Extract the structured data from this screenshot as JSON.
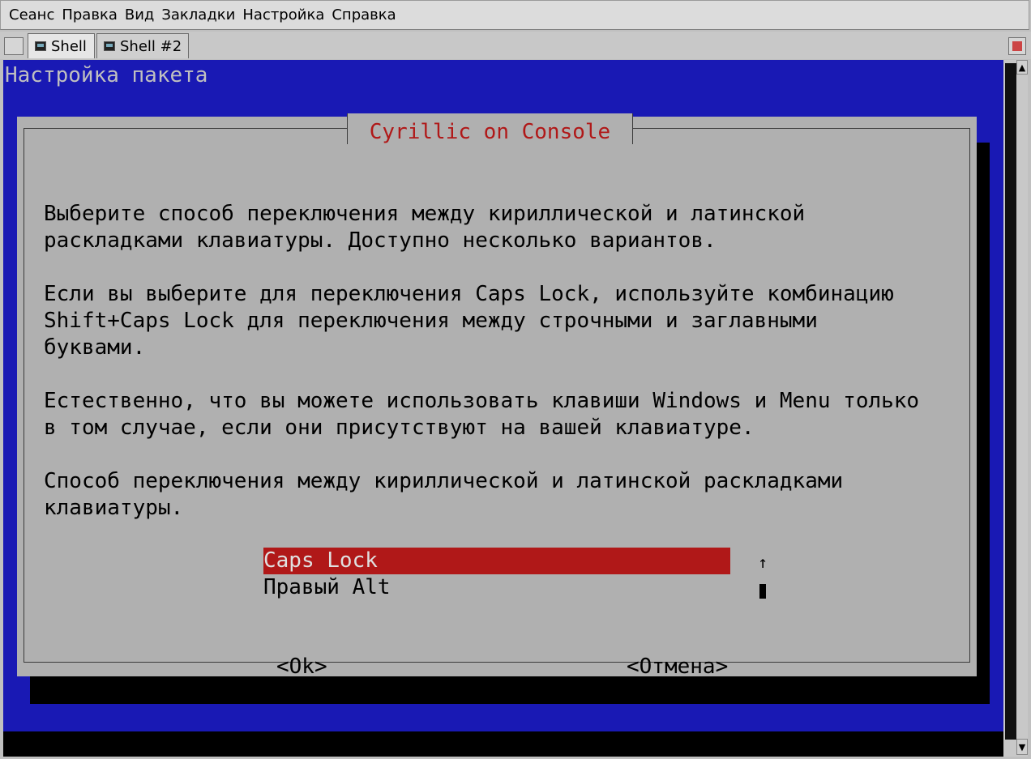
{
  "menu": [
    "Сеанс",
    "Правка",
    "Вид",
    "Закладки",
    "Настройка",
    "Справка"
  ],
  "tabs": [
    {
      "label": "Shell"
    },
    {
      "label": "Shell #2"
    }
  ],
  "terminal": {
    "backtitle": "Настройка пакета",
    "dialog": {
      "title": "Cyrillic on Console",
      "paragraphs": [
        "Выберите способ переключения между кириллической и латинской\nраскладками клавиатуры. Доступно несколько вариантов.",
        "Если вы выберите для переключения Caps Lock, используйте комбинацию\nShift+Caps Lock для переключения между строчными и заглавными\nбуквами.",
        "Естественно, что вы можете использовать клавиши Windows и Menu только\nв том случае, если они присутствуют на вашей клавиатуре.",
        "Способ переключения между кириллической и латинской раскладками\nклавиатуры."
      ],
      "choices": [
        "Caps Lock",
        "Правый Alt"
      ],
      "selected_index": 0,
      "scroll_arrow": "↑",
      "ok_label": "<Ok>",
      "cancel_label": "<Отмена>"
    }
  },
  "colors": {
    "terminal_bg": "#1919b4",
    "dialog_bg": "#b0b0b0",
    "title_red": "#b01818",
    "selection_bg": "#b01818"
  }
}
